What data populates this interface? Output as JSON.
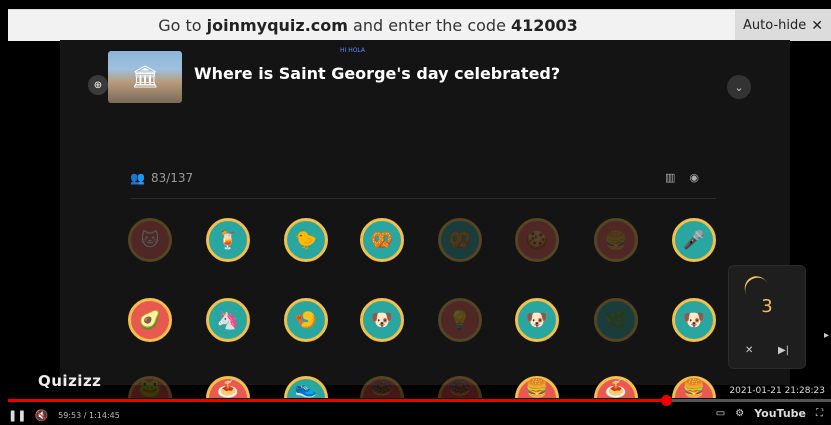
{
  "banner": {
    "prefix": "Go to ",
    "site": "joinmyquiz.com",
    "middle": " and enter the code ",
    "code": "412003",
    "autohide_label": "Auto-hide",
    "close_glyph": "✕"
  },
  "question": {
    "tag": "HI HOLA",
    "text": "Where is Saint George's day celebrated?",
    "zoom_icon": "zoom-in-icon",
    "expand_icon": "chevron-down-icon"
  },
  "players": {
    "icon": "users-icon",
    "answered": "83/137",
    "chart_icon": "bar-chart-icon",
    "user_icon": "user-icon"
  },
  "timer": {
    "value": "3",
    "mute_icon": "mute-icon",
    "skip_icon": "skip-icon"
  },
  "brand": {
    "logo": "Quizizz"
  },
  "video": {
    "current_time": "59:53",
    "duration": "1:14:45",
    "time_display": "59:53 / 1:14:45",
    "timestamp": "2021-01-21 21:28:23",
    "progress": 0.8,
    "progress_color": "#e00000",
    "player": "YouTube"
  },
  "avatars": [
    {
      "row": 0,
      "glyph": "🐱",
      "bg": "#e85a4f",
      "dim": true
    },
    {
      "row": 0,
      "glyph": "🍹",
      "bg": "#2aa6a0",
      "dim": false
    },
    {
      "row": 0,
      "glyph": "🐤",
      "bg": "#2aa6a0",
      "dim": false
    },
    {
      "row": 0,
      "glyph": "🥨",
      "bg": "#2aa6a0",
      "dim": false
    },
    {
      "row": 0,
      "glyph": "🥨",
      "bg": "#2aa6a0",
      "dim": true
    },
    {
      "row": 0,
      "glyph": "🍪",
      "bg": "#e85a4f",
      "dim": true
    },
    {
      "row": 0,
      "glyph": "🍔",
      "bg": "#e85a4f",
      "dim": true
    },
    {
      "row": 0,
      "glyph": "🎤",
      "bg": "#2aa6a0",
      "dim": false
    },
    {
      "row": 1,
      "glyph": "🥑",
      "bg": "#e85a4f",
      "dim": false
    },
    {
      "row": 1,
      "glyph": "🦄",
      "bg": "#2aa6a0",
      "dim": false
    },
    {
      "row": 1,
      "glyph": "🍤",
      "bg": "#2aa6a0",
      "dim": false
    },
    {
      "row": 1,
      "glyph": "🐶",
      "bg": "#2aa6a0",
      "dim": false
    },
    {
      "row": 1,
      "glyph": "💡",
      "bg": "#e85a4f",
      "dim": true
    },
    {
      "row": 1,
      "glyph": "🐶",
      "bg": "#2aa6a0",
      "dim": false
    },
    {
      "row": 1,
      "glyph": "🌿",
      "bg": "#2aa6a0",
      "dim": true
    },
    {
      "row": 1,
      "glyph": "🐶",
      "bg": "#2aa6a0",
      "dim": false
    },
    {
      "row": 2,
      "glyph": "🐸",
      "bg": "#e85a4f",
      "dim": true
    },
    {
      "row": 2,
      "glyph": "🍝",
      "bg": "#e85a4f",
      "dim": false
    },
    {
      "row": 2,
      "glyph": "👟",
      "bg": "#2aa6a0",
      "dim": false
    },
    {
      "row": 2,
      "glyph": "🍩",
      "bg": "#e85a4f",
      "dim": true
    },
    {
      "row": 2,
      "glyph": "🍩",
      "bg": "#e85a4f",
      "dim": true
    },
    {
      "row": 2,
      "glyph": "🍔",
      "bg": "#e85a4f",
      "dim": false
    },
    {
      "row": 2,
      "glyph": "🍝",
      "bg": "#e85a4f",
      "dim": false
    },
    {
      "row": 2,
      "glyph": "🍔",
      "bg": "#e85a4f",
      "dim": false
    }
  ]
}
